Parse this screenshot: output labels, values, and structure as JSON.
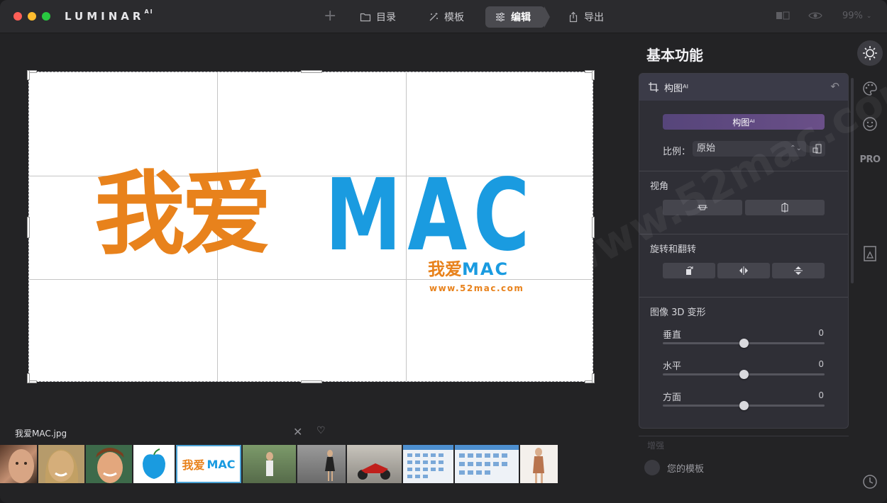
{
  "app": {
    "brand": "LUMINAR",
    "brand_sup": "AI"
  },
  "nav": {
    "catalog": "目录",
    "templates": "模板",
    "edit": "编辑",
    "export": "导出",
    "zoom": "99%"
  },
  "image": {
    "big_zh": "我爱",
    "big_en": "MAC",
    "small_zh": "我爱",
    "small_en": "MAC",
    "url": "www.52mac.com"
  },
  "filmstrip": {
    "filename": "我爱MAC.jpg",
    "thumb_logo_zh": "我爱",
    "thumb_logo_en": "MAC"
  },
  "panel": {
    "title": "基本功能",
    "tool_name": "构图ᴬᴵ",
    "compose_button": "构图ᴬᴵ",
    "ratio_label": "比例：",
    "ratio_value": "原始",
    "perspective_label": "视角",
    "rotate_label": "旋转和翻转",
    "transform3d_label": "图像 3D 变形",
    "sliders": [
      {
        "label": "垂直",
        "value": "0"
      },
      {
        "label": "水平",
        "value": "0"
      },
      {
        "label": "方面",
        "value": "0"
      }
    ],
    "next_tool": "增强",
    "my_templates": "您的模板"
  },
  "sidebar_icons": [
    "light-icon",
    "palette-icon",
    "face-icon",
    "pro-icon",
    "portrait-icon",
    "history-icon"
  ],
  "pro_label": "PRO",
  "watermark_text": "www.52mac.com",
  "colors": {
    "accent_orange": "#e8821c",
    "accent_blue": "#1a9be0",
    "compose_button": "#5e4a80"
  }
}
